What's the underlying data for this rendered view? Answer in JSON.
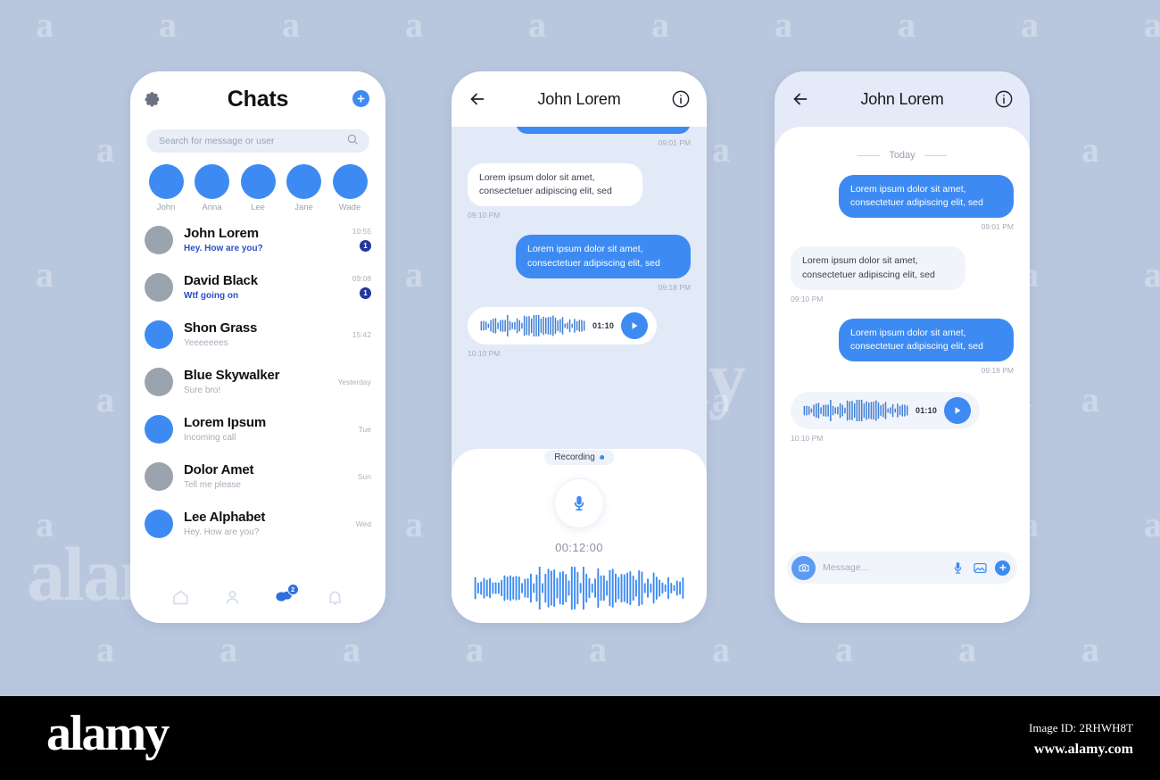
{
  "background_color": "#b9c7de",
  "accent_color": "#3d8bf2",
  "watermark": {
    "letter": "a",
    "brand": "alamy"
  },
  "phone1": {
    "header": {
      "title": "Chats",
      "gear_icon": "gear-icon",
      "add_icon": "plus-icon"
    },
    "search": {
      "placeholder": "Search for message or user",
      "value": "",
      "icon": "search-icon"
    },
    "stories": [
      {
        "name": "John"
      },
      {
        "name": "Anna"
      },
      {
        "name": "Lee"
      },
      {
        "name": "Jane"
      },
      {
        "name": "Wade"
      }
    ],
    "chats": [
      {
        "name": "John Lorem",
        "message": "Hey. How are you?",
        "time": "10:55",
        "badge": "1",
        "avatar": "gray",
        "unread": true
      },
      {
        "name": "David Black",
        "message": "Wtf going on",
        "time": "09:08",
        "badge": "1",
        "avatar": "gray",
        "unread": true
      },
      {
        "name": "Shon Grass",
        "message": "Yeeeeeees",
        "time": "15:42",
        "badge": "",
        "avatar": "blue",
        "unread": false
      },
      {
        "name": "Blue Skywalker",
        "message": "Sure bro!",
        "time": "Yesterday",
        "badge": "",
        "avatar": "gray",
        "unread": false
      },
      {
        "name": "Lorem Ipsum",
        "message": "Incoming call",
        "time": "Tue",
        "badge": "",
        "avatar": "blue",
        "unread": false
      },
      {
        "name": "Dolor Amet",
        "message": "Tell me please",
        "time": "Sun",
        "badge": "",
        "avatar": "gray",
        "unread": false
      },
      {
        "name": "Lee Alphabet",
        "message": "Hey. How are you?",
        "time": "Wed",
        "badge": "",
        "avatar": "blue",
        "unread": false
      }
    ],
    "tabs": [
      {
        "icon": "home-icon",
        "label": "",
        "badge": "",
        "active": false
      },
      {
        "icon": "person-icon",
        "label": "",
        "badge": "",
        "active": false
      },
      {
        "icon": "chat-bubbles-icon",
        "label": "",
        "badge": "2",
        "active": true
      },
      {
        "icon": "bell-icon",
        "label": "",
        "badge": "",
        "active": false
      }
    ]
  },
  "phone2": {
    "header": {
      "title": "John Lorem",
      "back_icon": "back-arrow-icon",
      "info_icon": "info-icon"
    },
    "messages": [
      {
        "type": "out",
        "text": "",
        "time": "09:01 PM"
      },
      {
        "type": "in",
        "text": "Lorem ipsum dolor sit amet, consectetuer adipiscing elit, sed",
        "time": "09:10 PM"
      },
      {
        "type": "out",
        "text": "Lorem ipsum dolor sit amet, consectetuer adipiscing elit, sed",
        "time": "09:18 PM"
      },
      {
        "type": "voice",
        "duration": "01:10",
        "time": "10:10 PM"
      }
    ],
    "recording": {
      "pill_label": "Recording",
      "mic_icon": "microphone-icon",
      "elapsed": "00:12:00"
    }
  },
  "phone3": {
    "header": {
      "title": "John Lorem",
      "back_icon": "back-arrow-icon",
      "info_icon": "info-icon"
    },
    "day_divider": "Today",
    "messages": [
      {
        "type": "out",
        "text": "Lorem ipsum dolor sit amet, consectetuer adipiscing elit, sed",
        "time": "09:01 PM"
      },
      {
        "type": "in",
        "text": "Lorem ipsum dolor sit amet, consectetuer adipiscing elit, sed",
        "time": "09:10 PM"
      },
      {
        "type": "out",
        "text": "Lorem ipsum dolor sit amet, consectetuer adipiscing elit, sed",
        "time": "09:18 PM"
      },
      {
        "type": "voice",
        "duration": "01:10",
        "time": "10:10 PM"
      }
    ],
    "input": {
      "placeholder": "Message...",
      "value": "",
      "camera_icon": "camera-icon",
      "mic_icon": "microphone-icon",
      "gallery_icon": "image-icon",
      "add_icon": "plus-icon"
    }
  },
  "footer": {
    "logo": "alamy",
    "image_id": "Image ID: 2RHWH8T",
    "url": "www.alamy.com"
  }
}
